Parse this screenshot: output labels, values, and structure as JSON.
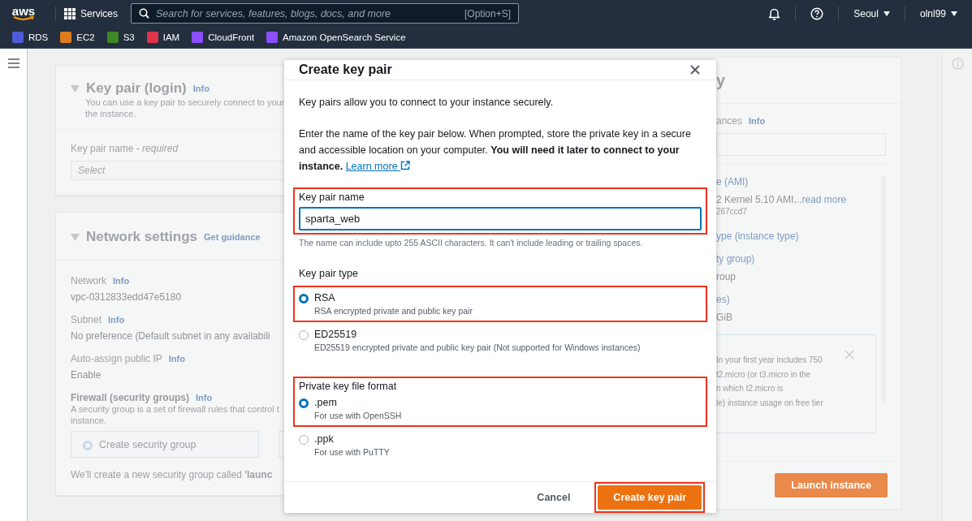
{
  "top_nav": {
    "logo": "aws",
    "services": "Services",
    "search": {
      "placeholder": "Search for services, features, blogs, docs, and more",
      "shortcut": "[Option+S]"
    },
    "region": "Seoul",
    "account": "olnl99"
  },
  "favorites": [
    {
      "label": "RDS",
      "color": "#4d5bd9"
    },
    {
      "label": "EC2",
      "color": "#e07b1d"
    },
    {
      "label": "S3",
      "color": "#3f8624"
    },
    {
      "label": "IAM",
      "color": "#dd344c"
    },
    {
      "label": "CloudFront",
      "color": "#8c4fff"
    },
    {
      "label": "Amazon OpenSearch Service",
      "color": "#8c4fff"
    }
  ],
  "key_pair_card": {
    "title": "Key pair (login)",
    "info": "Info",
    "description": [
      "You can use a key pair to securely connect to your",
      "the instance."
    ],
    "field_label": "Key pair name - *required*",
    "field_placeholder": "Select"
  },
  "network_card": {
    "title": "Network settings",
    "guidance": "Get guidance",
    "fields": [
      {
        "label": "Network",
        "info": "Info",
        "value": "vpc-0312833edd47e5180"
      },
      {
        "label": "Subnet",
        "info": "Info",
        "value": "No preference (Default subnet in any availabili"
      },
      {
        "label": "Auto-assign public IP",
        "info": "Info",
        "value": "Enable"
      }
    ],
    "firewall": {
      "label": "Firewall (security groups)",
      "info": "Info",
      "description": [
        "A security group is a set of firewall rules that control t",
        "instance."
      ],
      "choice": "Create security group",
      "choice_selected": true,
      "note": "We'll create a new security group called **'launc**"
    }
  },
  "summary_card": {
    "title": "y",
    "instances_label": "ances",
    "instances_info": "Info",
    "lines": [
      {
        "kind": "link",
        "text": "e (AMI)"
      },
      {
        "kind": "value",
        "text": "2 Kernel 5.10 AMI...",
        "link": "read more"
      },
      {
        "kind": "small",
        "text": "267ccd7"
      },
      {
        "kind": "link",
        "text": "ype (instance type)"
      },
      {
        "kind": "link",
        "text": "ty group)"
      },
      {
        "kind": "value",
        "text": "roup"
      },
      {
        "kind": "link",
        "text": "es)"
      },
      {
        "kind": "value",
        "text": "GiB"
      }
    ],
    "free_tier": [
      "In your first year includes 750",
      "t2.micro (or t3.micro in the",
      "n which t2.micro is",
      "le) instance usage on free tier"
    ],
    "launch_button": "Launch instance"
  },
  "dialog": {
    "title": "Create key pair",
    "intro": "Key pairs allow you to connect to your instance securely.",
    "details": "Enter the name of the key pair below. When prompted, store the private key in a secure and accessible location on your computer. **You will need it later to connect to your instance.**",
    "learn_more": "Learn more",
    "name_field": {
      "label": "Key pair name",
      "value": "sparta_web",
      "hint": "The name can include upto 255 ASCII characters. It can't include leading or trailing spaces.",
      "highlighted": true
    },
    "groups": [
      {
        "label": "Key pair type",
        "label_highlighted": false,
        "options": [
          {
            "label": "RSA",
            "description": "RSA encrypted private and public key pair",
            "selected": true,
            "highlighted": true
          },
          {
            "label": "ED25519",
            "description": "ED25519 encrypted private and public key pair (Not supported for Windows instances)",
            "selected": false,
            "highlighted": false
          }
        ]
      },
      {
        "label": "Private key file format",
        "label_highlighted": true,
        "options": [
          {
            "label": ".pem",
            "description": "For use with OpenSSH",
            "selected": true,
            "highlighted": true
          },
          {
            "label": ".ppk",
            "description": "For use with PuTTY",
            "selected": false,
            "highlighted": false
          }
        ]
      }
    ],
    "cancel": "Cancel",
    "create": {
      "label": "Create key pair",
      "highlighted": true
    }
  }
}
